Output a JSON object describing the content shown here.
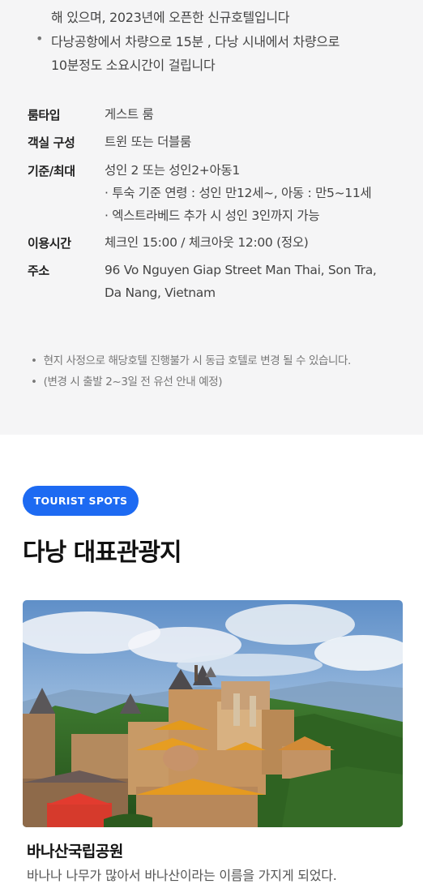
{
  "hotel_intro": {
    "line1": "해 있으며, 2023년에 오픈한 신규호텔입니다",
    "bullet2_line1": "다낭공항에서 차량으로 15분 , 다낭 시내에서 차량으로",
    "bullet2_line2": "10분정도 소요시간이 걸립니다",
    "bullet_symbol": "•"
  },
  "specs": {
    "room_type": {
      "label": "룸타입",
      "value": "게스트 룸"
    },
    "room_config": {
      "label": "객실 구성",
      "value": "트윈 또는 더블룸"
    },
    "occupancy": {
      "label": "기준/최대",
      "value": "성인 2 또는 성인2+아동1",
      "sub1": "· 투숙 기준 연령 :  성인 만12세~, 아동 : 만5~11세",
      "sub2": "· 엑스트라베드 추가 시 성인 3인까지 가능"
    },
    "hours": {
      "label": "이용시간",
      "value": "체크인 15:00 / 체크아웃 12:00 (정오)"
    },
    "address": {
      "label": "주소",
      "line1": "96 Vo Nguyen Giap Street Man Thai, Son Tra,",
      "line2": "Da Nang, Vietnam"
    }
  },
  "notes": {
    "note1": "현지 사정으로 해당호텔 진행불가 시 동급 호텔로 변경 될 수 있습니다.",
    "note2": "(변경 시 출발 2~3일 전 유선 안내 예정)",
    "dot": "•"
  },
  "tourist": {
    "badge": "TOURIST SPOTS",
    "title": "다낭 대표관광지",
    "spot_name": "바나산국립공원",
    "spot_desc": "바나나 나무가 많아서 바나산이라는 이름을 가지게 되었다."
  },
  "colors": {
    "badge_bg": "#1d6af2",
    "info_bg": "#f5f5f6"
  }
}
